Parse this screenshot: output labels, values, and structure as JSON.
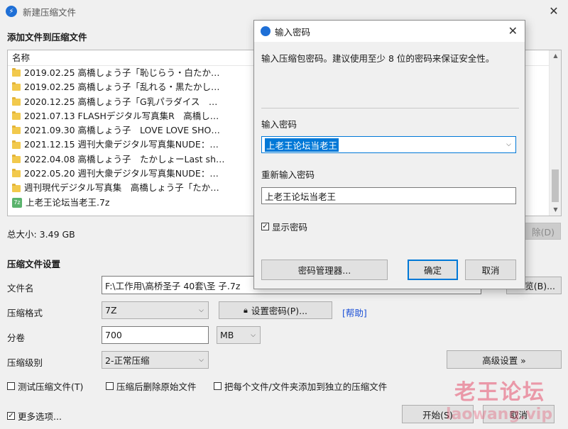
{
  "window": {
    "title": "新建压缩文件",
    "close_glyph": "✕"
  },
  "files_section": {
    "title": "添加文件到压缩文件",
    "header_name": "名称",
    "items": [
      {
        "icon": "folder-icon",
        "name": "2019.02.25 高橋しょう子「恥じらう・白たか…"
      },
      {
        "icon": "folder-icon",
        "name": "2019.02.25 高橋しょう子「乱れる・黒たかし…"
      },
      {
        "icon": "folder-icon",
        "name": "2020.12.25 高橋しょう子「G乳パラダイス　…"
      },
      {
        "icon": "folder-icon",
        "name": "2021.07.13 FLASHデジタル写真集R　高橋し…"
      },
      {
        "icon": "folder-icon",
        "name": "2021.09.30 高橋しょう子　LOVE LOVE SHO…"
      },
      {
        "icon": "folder-icon",
        "name": "2021.12.15 週刊大衆デジタル写真集NUDE：…"
      },
      {
        "icon": "folder-icon",
        "name": "2022.04.08 高橋しょう子　たかしょーLast sh…"
      },
      {
        "icon": "folder-icon",
        "name": "2022.05.20 週刊大衆デジタル写真集NUDE：…"
      },
      {
        "icon": "folder-icon",
        "name": "週刊現代デジタル写真集　高橋しょう子「たか…"
      },
      {
        "icon": "archive-icon",
        "name": "上老王论坛当老王.7z"
      }
    ],
    "total_size": "总大小: 3.49 GB",
    "delete_button_fragment": "除(D)"
  },
  "settings_section": {
    "title": "压缩文件设置",
    "filename_label": "文件名",
    "filename_value": "F:\\工作用\\高桥圣子 40套\\圣 子.7z",
    "browse_button_fragment": "览(B)...",
    "format_label": "压缩格式",
    "format_value": "7Z",
    "set_password_button": "设置密码(P)...",
    "help_link": "[帮助]",
    "split_label": "分卷",
    "split_value": "700",
    "split_unit": "MB",
    "level_label": "压缩级别",
    "level_value": "2-正常压缩",
    "advanced_button": "高级设置 »",
    "check_test": "测试压缩文件(T)",
    "check_delete": "压缩后删除原始文件",
    "check_separate": "把每个文件/文件夹添加到独立的压缩文件",
    "more_options": "更多选项...",
    "start_button": "开始(S)",
    "cancel_button": "取消"
  },
  "password_dialog": {
    "title": "输入密码",
    "close_glyph": "✕",
    "hint": "输入压缩包密码。建议使用至少 8 位的密码来保证安全性。",
    "password_label": "输入密码",
    "password_value": "上老王论坛当老王",
    "reenter_label": "重新输入密码",
    "reenter_value": "上老王论坛当老王",
    "show_password": "显示密码",
    "password_manager_button": "密码管理器...",
    "ok_button": "确定",
    "cancel_button": "取消"
  },
  "watermark": {
    "line1": "老王论坛",
    "line2": "laowang.vip"
  },
  "colors": {
    "accent": "#1e6fd6",
    "selection": "#0078d7",
    "link": "#1a4fd6"
  }
}
